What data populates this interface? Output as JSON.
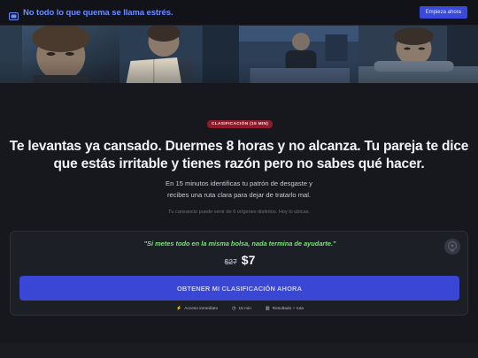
{
  "topbar": {
    "brand_icon": "brain-chip-icon",
    "brand_text": "No todo lo que quema se llama estrés.",
    "cta_label": "Empieza ahora"
  },
  "hero": {
    "panels": [
      "woman-portrait",
      "man-reading-book",
      "man-sitting-on-bed",
      "man-in-bed"
    ]
  },
  "main": {
    "badge": "CLASIFICACIÓN (15 MIN)",
    "headline_line1": "Te levantas ya cansado. Duermes 8 horas y no alcanza. Tu pareja te dice",
    "headline_line2": "que estás irritable y tienes razón pero no sabes qué hacer.",
    "sub_line1": "En 15 minutos identificas tu patrón de desgaste y",
    "sub_line2": "recibes una ruta clara para dejar de tratarlo mal.",
    "note": "Tu cansancio puede venir de 6 orígenes distintos. Hoy lo ubicas."
  },
  "offer": {
    "quote": "\"Si metes todo en la misma bolsa, nada termina de ayudarte.\"",
    "price_old": "$27",
    "price_new": "$7",
    "cta_label": "OBTENER MI CLASIFICACIÓN AHORA",
    "features": [
      {
        "icon": "lightning-icon",
        "label": "Acceso inmediato"
      },
      {
        "icon": "clock-icon",
        "label": "15 min"
      },
      {
        "icon": "chart-icon",
        "label": "Resultado + ruta"
      }
    ]
  },
  "colors": {
    "accent": "#3a46d4",
    "brand_text": "#6d8cff",
    "badge_bg": "#8e1a2a",
    "quote": "#7ee07c",
    "background": "#17181e"
  }
}
